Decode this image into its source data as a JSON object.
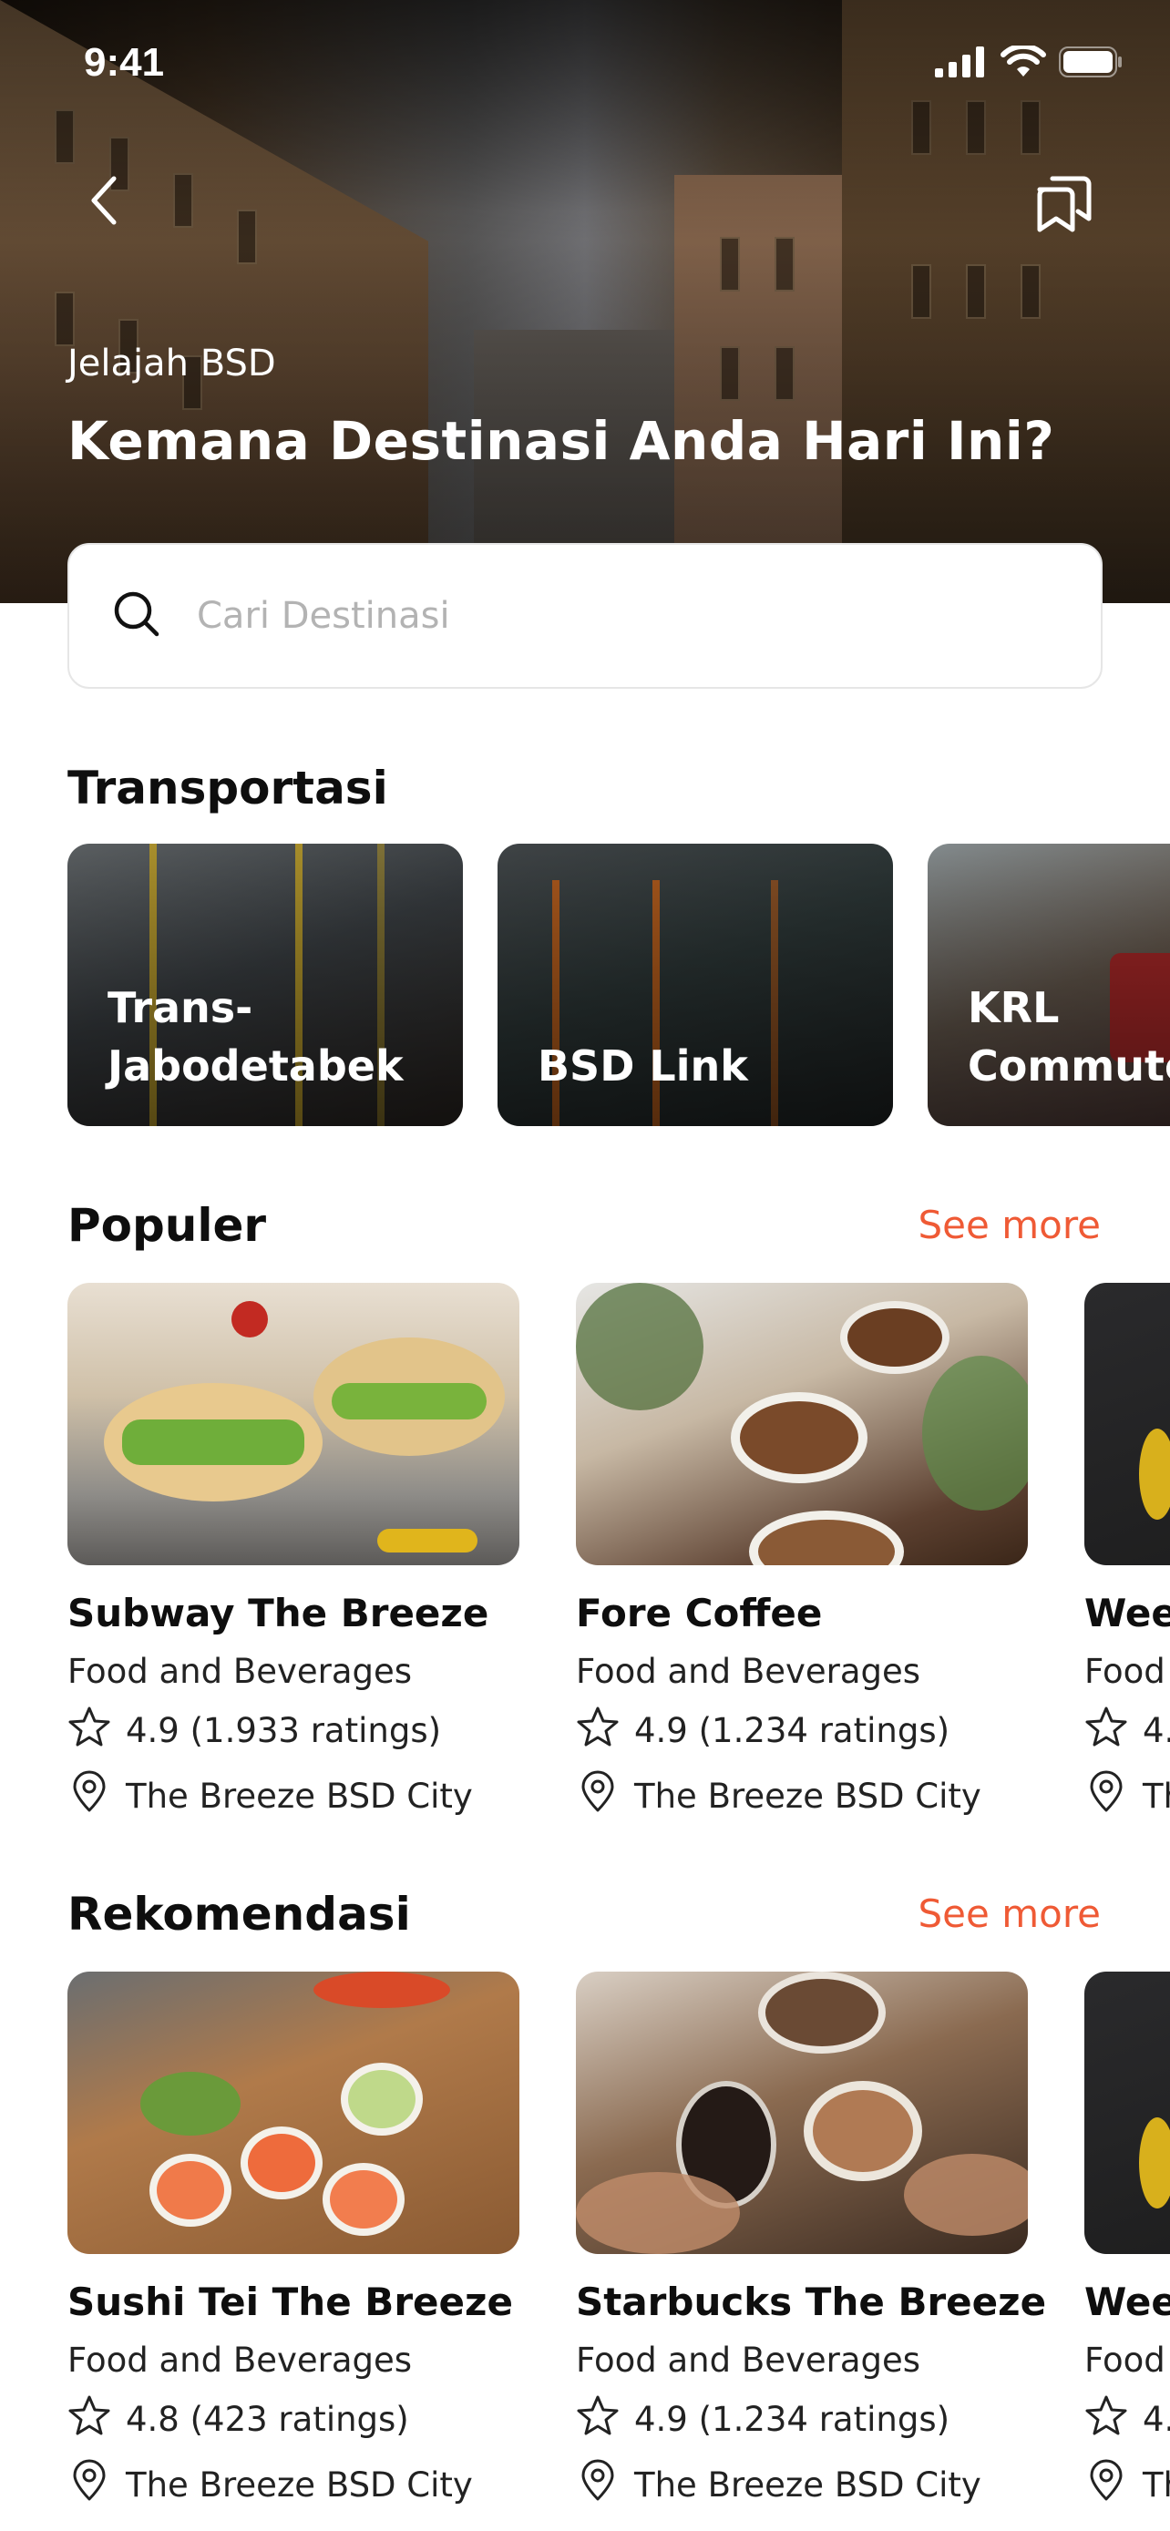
{
  "status_bar": {
    "time": "9:41"
  },
  "hero": {
    "eyebrow": "Jelajah BSD",
    "title": "Kemana Destinasi Anda Hari Ini?"
  },
  "search": {
    "placeholder": "Cari Destinasi",
    "value": ""
  },
  "transport": {
    "title": "Transportasi",
    "items": [
      {
        "label": "Trans-\nJabodetabek"
      },
      {
        "label": "BSD Link"
      },
      {
        "label": "KRL\nCommuter"
      }
    ]
  },
  "popular": {
    "title": "Populer",
    "see_more": "See more",
    "items": [
      {
        "name": "Subway The Breeze",
        "category": "Food and Beverages",
        "rating": "4.9 (1.933 ratings)",
        "location": "The Breeze BSD City"
      },
      {
        "name": "Fore Coffee",
        "category": "Food and Beverages",
        "rating": "4.9 (1.234 ratings)",
        "location": "The Breeze BSD City"
      },
      {
        "name": "Wee",
        "category": "Food",
        "rating": "4.",
        "location": "Th"
      }
    ]
  },
  "recommend": {
    "title": "Rekomendasi",
    "see_more": "See more",
    "items": [
      {
        "name": "Sushi Tei The Breeze",
        "category": "Food and Beverages",
        "rating": "4.8 (423 ratings)",
        "location": "The Breeze BSD City"
      },
      {
        "name": "Starbucks The Breeze",
        "category": "Food and Beverages",
        "rating": "4.9 (1.234 ratings)",
        "location": "The Breeze BSD City"
      },
      {
        "name": "Wee",
        "category": "Food",
        "rating": "4.",
        "location": "Th"
      }
    ]
  },
  "colors": {
    "accent": "#ef5a35",
    "text": "#0e0e0e",
    "border": "#e6e6e6"
  },
  "icons": [
    "back-arrow-icon",
    "bookmark-icon",
    "search-icon",
    "star-icon",
    "location-pin-icon",
    "signal-icon",
    "wifi-icon",
    "battery-icon"
  ]
}
